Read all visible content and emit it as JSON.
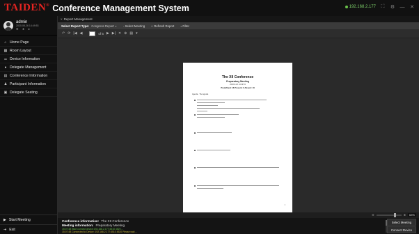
{
  "app": {
    "logo": "TAIDEN",
    "logo_mark": "®",
    "title": "Conference Management System",
    "ip": "192.168.2.177"
  },
  "window_controls": [
    "⛶",
    "⚙",
    "—",
    "✕"
  ],
  "user": {
    "name": "admin",
    "date": "2020-08-26 14:49:53",
    "icons": "⚙ ★ ●"
  },
  "sidebar": {
    "items": [
      {
        "icon": "home-icon",
        "glyph": "⌂",
        "label": "Home Page"
      },
      {
        "icon": "layout-icon",
        "glyph": "▦",
        "label": "Room Layout"
      },
      {
        "icon": "device-icon",
        "glyph": "⚌",
        "label": "Device Information"
      },
      {
        "icon": "delegate-icon",
        "glyph": "●",
        "label": "Delegate Management"
      },
      {
        "icon": "conference-icon",
        "glyph": "▤",
        "label": "Conference Information"
      },
      {
        "icon": "participant-icon",
        "glyph": "♟",
        "label": "Participant Information"
      },
      {
        "icon": "seating-icon",
        "glyph": "▣",
        "label": "Delegate Seating"
      }
    ],
    "start_meeting": "Start Meeting",
    "exit": "Exit"
  },
  "tab": {
    "label": "Report Management",
    "close": "×"
  },
  "filters": {
    "report_type_label": "Select Report Type:",
    "report_type_value": "Congress Report",
    "meeting_label": "Select Meeting",
    "refresh_label": "Refresh Report",
    "filter_label": "Filter"
  },
  "toolbar": {
    "page_current": "1",
    "page_of": "of 5"
  },
  "document": {
    "title": "The XII Conference",
    "subtitle": "Preparatory Meeting",
    "date": "2020-8-26 14:49:53",
    "counts": "Predefined: 16    Present: 0    Absent: 16",
    "agenda_heading": "Agenda · The Agenda",
    "page_number": "1"
  },
  "zoom": {
    "percent": "63%"
  },
  "info": {
    "conference_label": "Conference information:",
    "conference_value": "The XII Conference",
    "meeting_label": "Meeting information:",
    "meeting_value": "Preparatory Meeting",
    "log_line_1": "15:07:48   Start connect device:192.168.2.177:4510 4520 ...",
    "log_line_2": "15:07:48   Connected to Device: 192.168.2.177:4510 4520 Please wait ...",
    "select_meeting_btn": "Select Meeting",
    "connect_device_btn": "Connect Device"
  },
  "colors": {
    "brand": "#e52421",
    "ip_status": "#7fd36b",
    "log_primary": "#6ac24a",
    "log_secondary": "#c8b53a"
  }
}
